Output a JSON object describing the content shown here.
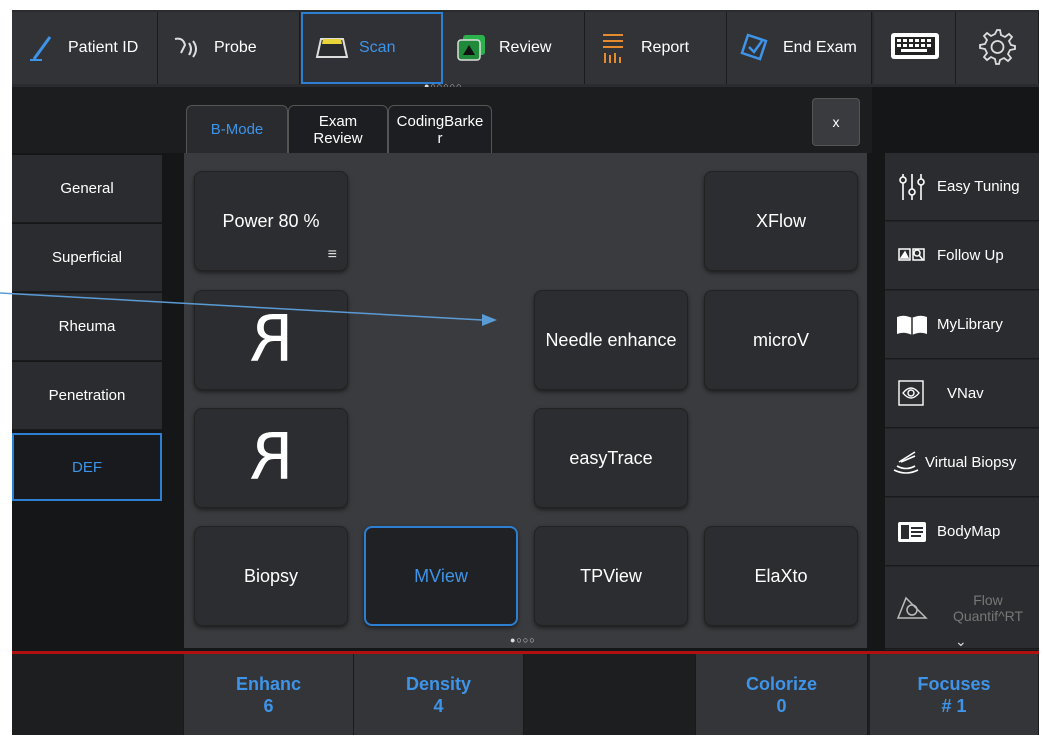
{
  "topbar": {
    "patient_id": "Patient ID",
    "probe": "Probe",
    "scan": "Scan",
    "review": "Review",
    "report": "Report",
    "end_exam": "End Exam",
    "page_dots": "●○○○○○"
  },
  "tabs": [
    {
      "label": "B-Mode"
    },
    {
      "label": "Exam Review"
    },
    {
      "label": "CodingBarke r"
    }
  ],
  "close_label": "x",
  "presets": [
    "General",
    "Superficial",
    "Rheuma",
    "Penetration",
    "DEF"
  ],
  "main_buttons": {
    "power": "Power 80 %",
    "xflow": "XFlow",
    "flip_h": "R",
    "needle": "Needle enhance",
    "microv": "microV",
    "flip_v": "R",
    "easytrace": "easyTrace",
    "biopsy": "Biopsy",
    "mview": "MView",
    "tpview": "TPView",
    "elaxto": "ElaXto",
    "page_dots": "●○○○"
  },
  "right_tools": {
    "easy_tuning": "Easy Tuning",
    "follow_up": "Follow Up",
    "mylibrary": "MyLibrary",
    "vnav": "VNav",
    "virtual_biopsy": "Virtual Biopsy",
    "bodymap": "BodyMap",
    "flow_quantif": "Flow Quantif^RT"
  },
  "bottom": {
    "enhanc_label": "Enhanc",
    "enhanc_value": "6",
    "density_label": "Density",
    "density_value": "4",
    "colorize_label": "Colorize",
    "colorize_value": "0",
    "focuses_label": "Focuses",
    "focuses_value": "# 1"
  },
  "colors": {
    "accent": "#3e94e8",
    "selection_border": "#2d7fd2",
    "divider": "#b01010",
    "arrow": "#5b9bd5"
  }
}
